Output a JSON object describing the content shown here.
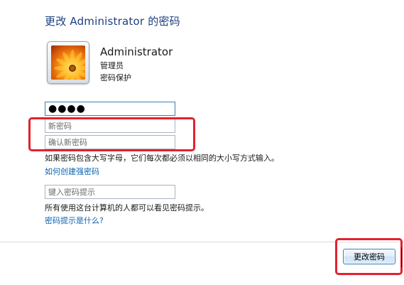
{
  "page": {
    "title": "更改 Administrator 的密码"
  },
  "user": {
    "name": "Administrator",
    "role": "管理员",
    "status": "密码保护",
    "avatar_icon": "orange-flower-icon"
  },
  "form": {
    "current_password_value": "●●●●",
    "new_password_placeholder": "新密码",
    "confirm_password_placeholder": "确认新密码",
    "case_note": "如果密码包含大写字母，它们每次都必须以相同的大小写方式输入。",
    "strong_password_link": "如何创建强密码",
    "hint_placeholder": "键入密码提示",
    "hint_note": "所有使用这台计算机的人都可以看见密码提示。",
    "hint_link": "密码提示是什么?"
  },
  "actions": {
    "change_button": "更改密码"
  },
  "colors": {
    "title": "#1e3f80",
    "link": "#0a64b4",
    "highlight": "#e2212f",
    "field_border": "#aab4c0",
    "focus_border": "#3c7fb1"
  }
}
